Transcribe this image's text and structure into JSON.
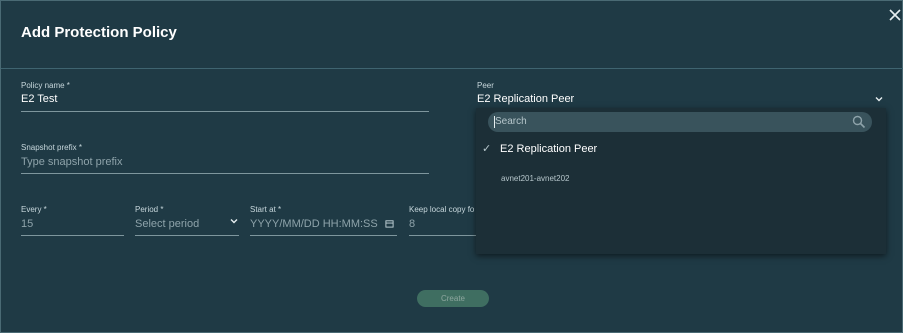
{
  "dialog": {
    "title": "Add Protection Policy",
    "create_label": "Create"
  },
  "form": {
    "policy_name": {
      "label": "Policy name *",
      "value": "E2 Test"
    },
    "peer": {
      "label": "Peer",
      "value": "E2 Replication Peer"
    },
    "snapshot_prefix": {
      "label": "Snapshot prefix *",
      "placeholder": "Type snapshot prefix"
    },
    "every": {
      "label": "Every *",
      "value": "15"
    },
    "period": {
      "label": "Period *",
      "placeholder": "Select period"
    },
    "start_at": {
      "label": "Start at *",
      "placeholder": "YYYY/MM/DD HH:MM:SS"
    },
    "keep_local": {
      "label": "Keep local copy fo",
      "value": "8"
    }
  },
  "peer_dropdown": {
    "search_placeholder": "Search",
    "options": [
      {
        "label": "E2 Replication Peer",
        "selected": true
      },
      {
        "label": "avnet201-avnet202",
        "selected": false
      }
    ]
  },
  "colors": {
    "background": "#1f3a45",
    "dropdown": "#1c2f37",
    "button": "#3f6e61"
  }
}
